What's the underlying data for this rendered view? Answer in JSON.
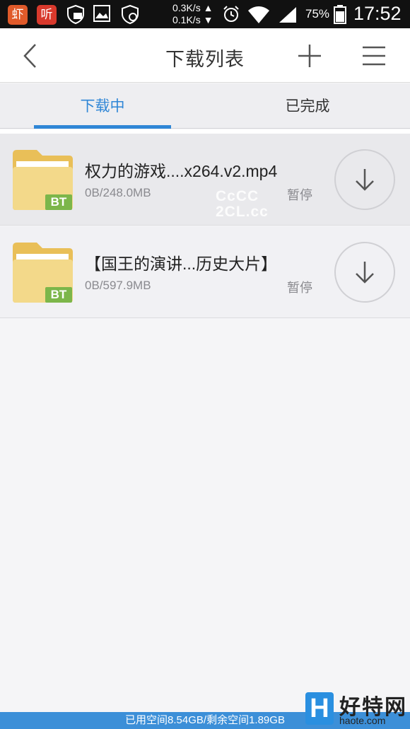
{
  "status_bar": {
    "app1": "虾",
    "app2": "听",
    "net_up": "0.3K/s ▲",
    "net_down": "0.1K/s ▼",
    "battery": "75%",
    "time": "17:52"
  },
  "header": {
    "title": "下载列表",
    "icons": [
      "back-arrow",
      "plus",
      "menu"
    ]
  },
  "tabs": [
    {
      "label": "下载中",
      "active": true
    },
    {
      "label": "已完成",
      "active": false
    }
  ],
  "downloads": [
    {
      "title": "权力的游戏....x264.v2.mp4",
      "size": "0B/248.0MB",
      "status": "暂停",
      "badge": "BT"
    },
    {
      "title": "【国王的演讲...历史大片】",
      "size": "0B/597.9MB",
      "status": "暂停",
      "badge": "BT"
    }
  ],
  "watermark": {
    "line1": "CcCC",
    "line2": "2CL.cc"
  },
  "footer": {
    "storage": "已用空间8.54GB/剩余空间1.89GB"
  },
  "brand": {
    "mark": "H",
    "name": "好特网",
    "domain": "haote.com"
  },
  "colors": {
    "accent": "#2f86d6",
    "folder": "#f3d98a",
    "badge": "#7cb64a",
    "footer": "#3c8fd8"
  }
}
